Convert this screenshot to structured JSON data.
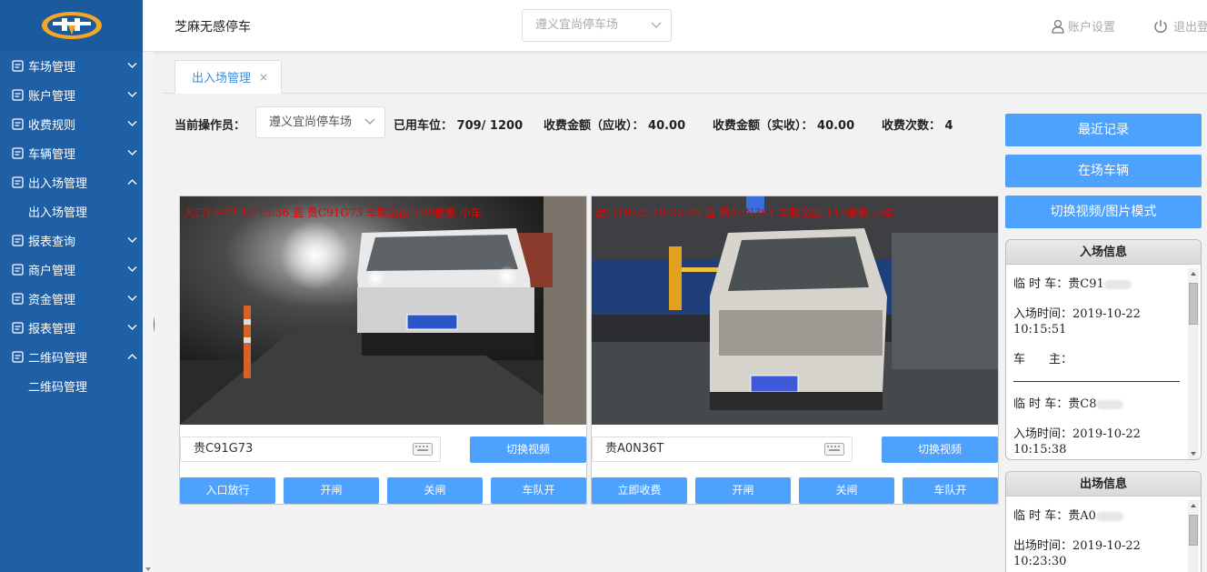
{
  "app": {
    "title": "芝麻无感停车"
  },
  "header": {
    "lot_select": "遵义宜尚停车场",
    "account_settings": "账户设置",
    "logout": "退出登录"
  },
  "sidebar": {
    "items": [
      {
        "label": "车场管理",
        "icon": "parking-lot-icon",
        "expanded": false
      },
      {
        "label": "账户管理",
        "icon": "card-icon",
        "expanded": false
      },
      {
        "label": "收费规则",
        "icon": "fee-icon",
        "expanded": false
      },
      {
        "label": "车辆管理",
        "icon": "car-list-icon",
        "expanded": false
      },
      {
        "label": "出入场管理",
        "icon": "gate-icon",
        "expanded": true,
        "sub": [
          "出入场管理"
        ]
      },
      {
        "label": "报表查询",
        "icon": "report-search-icon",
        "expanded": false
      },
      {
        "label": "商户管理",
        "icon": "merchant-icon",
        "expanded": false
      },
      {
        "label": "资金管理",
        "icon": "fund-icon",
        "expanded": false
      },
      {
        "label": "报表管理",
        "icon": "report-icon",
        "expanded": false
      },
      {
        "label": "二维码管理",
        "icon": "qrcode-icon",
        "expanded": true,
        "sub": [
          "二维码管理"
        ]
      }
    ]
  },
  "tabs": [
    {
      "label": "出入场管理",
      "close": "×"
    }
  ],
  "status": {
    "operator_label": "当前操作员：",
    "operator_value": "遵义宜尚停车场",
    "used_spaces": "已用车位：  709/ 1200",
    "fee_due": "收费金额（应收）：  40.00",
    "fee_paid": "收费金额（实收）：  40.00",
    "fee_count": "收费次数：  4"
  },
  "cameras": [
    {
      "overlay": "入口10-22 10:15:36 蓝 贵C91G73 车牌宽度:120像素 小车",
      "plate": "贵C91G73",
      "switch_label": "切换视频",
      "buttons": [
        "入口放行",
        "开闸",
        "关闸",
        "车队开"
      ]
    },
    {
      "overlay": "出口10-22 10:22:09 蓝 贵A0N36T 车牌宽度:115像素 小车",
      "plate": "贵A0N36T",
      "switch_label": "切换视频",
      "buttons": [
        "立即收费",
        "开闸",
        "关闸",
        "车队开"
      ]
    }
  ],
  "right": {
    "buttons": [
      "最近记录",
      "在场车辆",
      "切换视频/图片模式"
    ],
    "entry_info": {
      "title": "入场信息",
      "records": [
        {
          "type": "临 时 车：贵C91",
          "time_label": "入场时间：2019-10-22",
          "time": "10:15:51",
          "owner": "车　　主："
        },
        {
          "type": "临 时 车：贵C8",
          "time_label": "入场时间：2019-10-22",
          "time": "10:15:38"
        }
      ]
    },
    "exit_info": {
      "title": "出场信息",
      "records": [
        {
          "type": "临 时 车：贵A0",
          "time_label": "出场时间：2019-10-22",
          "time": "10:23:30"
        }
      ]
    }
  },
  "colors": {
    "sidebar": "#1f5fa5",
    "accent": "#4da1ff",
    "overlay_text": "#ee0000"
  }
}
